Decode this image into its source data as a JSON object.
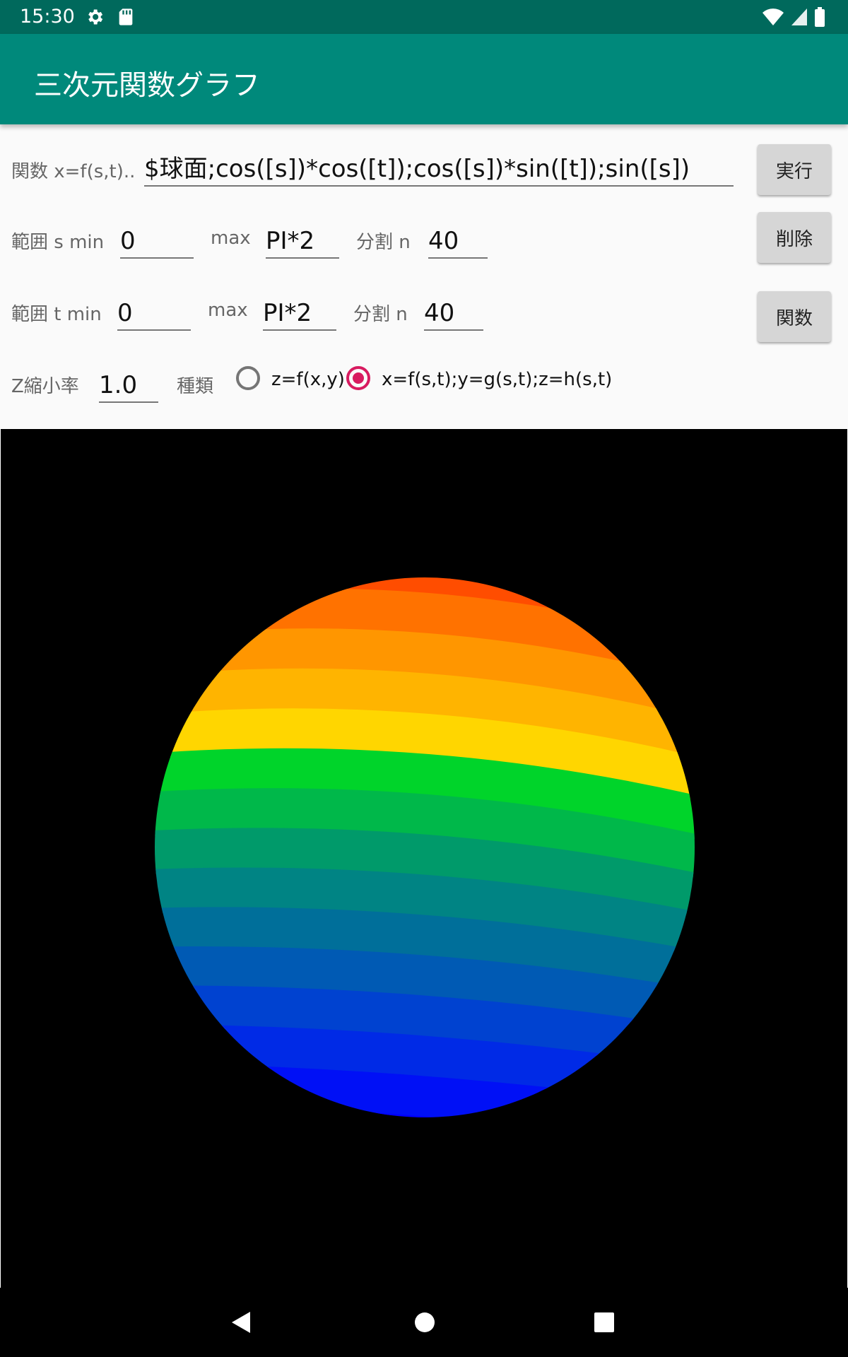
{
  "status": {
    "time": "15:30"
  },
  "app": {
    "title": "三次元関数グラフ"
  },
  "form": {
    "func_label": "関数 x=f(s,t)..",
    "func_value": "$球面;cos([s])*cos([t]);cos([s])*sin([t]);sin([s])",
    "s_label": "範囲 s min",
    "s_min": "0",
    "s_max_label": "max",
    "s_max": "PI*2",
    "s_div_label": "分割 n",
    "s_div": "40",
    "t_label": "範囲 t min",
    "t_min": "0",
    "t_max_label": "max",
    "t_max": "PI*2",
    "t_div_label": "分割 n",
    "t_div": "40",
    "z_label": "Z縮小率",
    "z_value": "1.0",
    "type_label": "種類",
    "radio_options": [
      "z=f(x,y)",
      "x=f(s,t);y=g(s,t);z=h(s,t)"
    ],
    "selected_option": 1
  },
  "buttons": {
    "run": "実行",
    "delete": "削除",
    "function": "関数"
  },
  "colors": {
    "statusbar": "#00695c",
    "appbar": "#00897b",
    "radio_accent": "#d81b60",
    "sphere_bands": [
      "#ff2200",
      "#ff4d00",
      "#ff7200",
      "#ff9600",
      "#ffb400",
      "#ffd600",
      "#00d42a",
      "#00b84a",
      "#009a6a",
      "#008484",
      "#006f9a",
      "#005ab4",
      "#0042d0",
      "#002ae6",
      "#0010f6",
      "#0000ff"
    ]
  },
  "icons": {
    "status_left": [
      "gear-icon",
      "sd-card-icon"
    ],
    "status_right": [
      "wifi-icon",
      "signal-icon",
      "battery-icon"
    ],
    "nav": [
      "back-icon",
      "home-icon",
      "recents-icon"
    ]
  }
}
